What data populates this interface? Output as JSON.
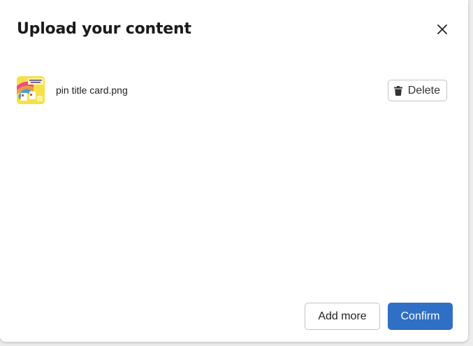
{
  "dialog": {
    "title": "Upload your content",
    "close_icon": "close-icon"
  },
  "files": [
    {
      "name": "pin title card.png",
      "thumbnail_icon": "image-thumbnail",
      "delete_label": "Delete",
      "delete_icon": "trash-icon"
    }
  ],
  "footer": {
    "add_more_label": "Add more",
    "confirm_label": "Confirm"
  },
  "colors": {
    "primary": "#2f6fc6",
    "border": "#c4c4c4",
    "text": "#1a1a1a"
  }
}
